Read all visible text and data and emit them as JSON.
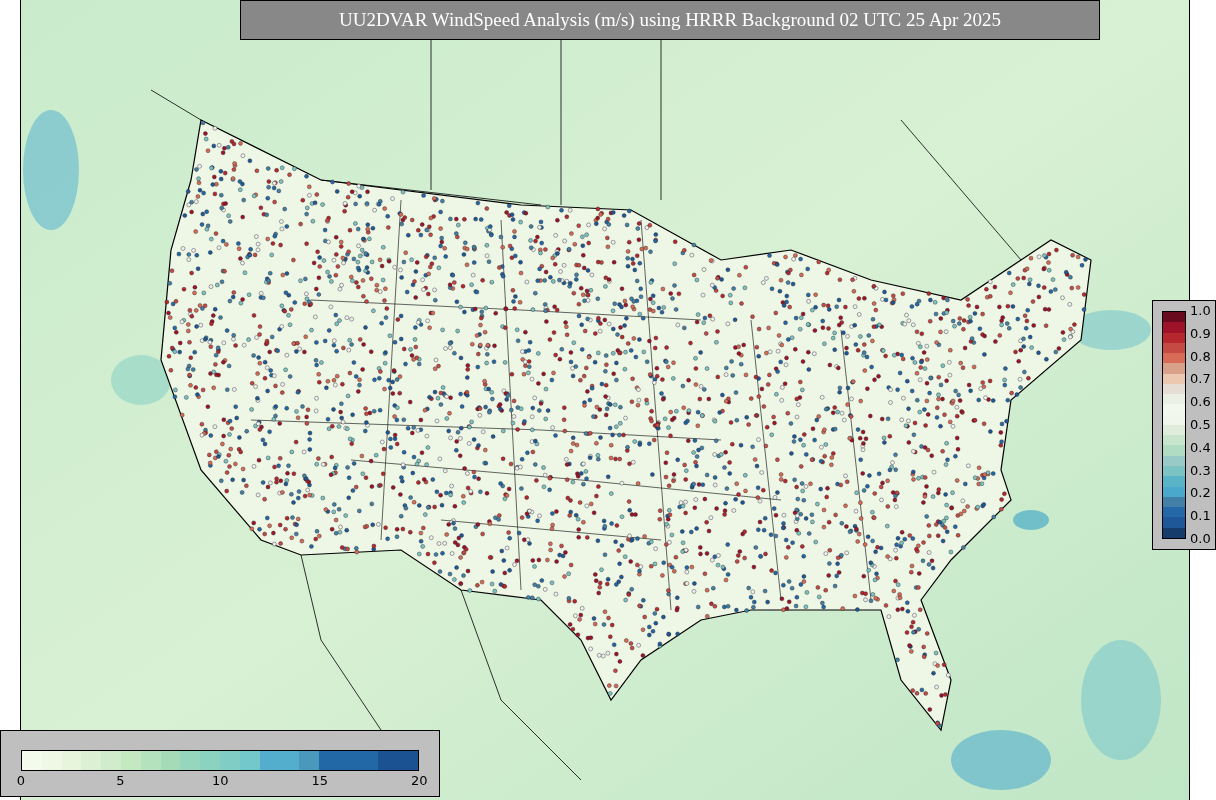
{
  "title": "UU2DVAR WindSpeed Analysis (m/s) using HRRR Background 02 UTC 25 Apr 2025",
  "station_colorbar": {
    "ticks": [
      "1.0",
      "0.9",
      "0.8",
      "0.7",
      "0.6",
      "0.5",
      "0.4",
      "0.3",
      "0.2",
      "0.1",
      "0.0"
    ]
  },
  "windspeed_colorbar": {
    "ticks": [
      "0",
      "5",
      "10",
      "15",
      "20"
    ]
  }
}
